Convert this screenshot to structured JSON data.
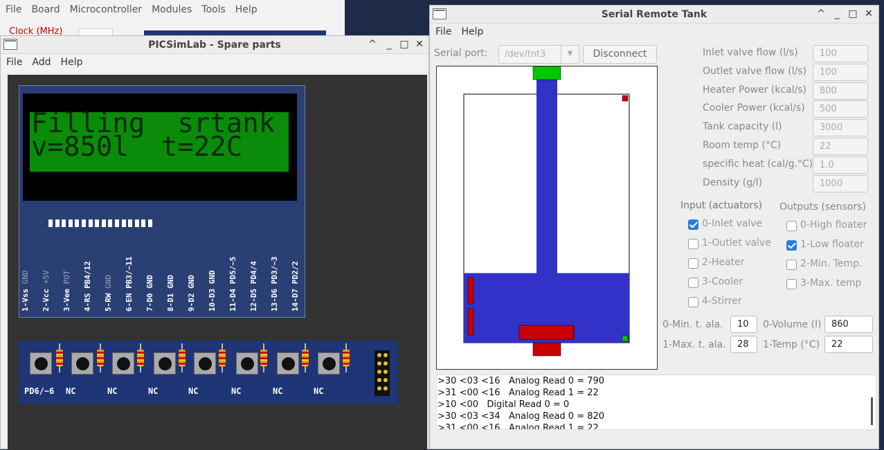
{
  "back_window": {
    "menu": [
      "File",
      "Board",
      "Microcontroller",
      "Modules",
      "Tools",
      "Help"
    ],
    "clock_label": "Clock (MHz)"
  },
  "parts_window": {
    "title": "PICSimLab - Spare parts",
    "menu": [
      "File",
      "Add",
      "Help"
    ],
    "lcd": {
      "line1": "Filling  srtank",
      "line2": "v=850l  t=22C",
      "pins": [
        {
          "label": "1-Vss",
          "net": "GND"
        },
        {
          "label": "2-Vcc",
          "net": "+5V"
        },
        {
          "label": "3-Vee",
          "net": "POT"
        },
        {
          "label": "4-RS",
          "net": "PB4/12"
        },
        {
          "label": "5-RW",
          "net": "GND"
        },
        {
          "label": "6-EN",
          "net": "PB3/~11"
        },
        {
          "label": "7-D0",
          "net": "GND"
        },
        {
          "label": "8-D1",
          "net": "GND"
        },
        {
          "label": "9-D2",
          "net": "GND"
        },
        {
          "label": "10-D3",
          "net": "GND"
        },
        {
          "label": "11-D4",
          "net": "PD5/~5"
        },
        {
          "label": "12-D5",
          "net": "PD4/4"
        },
        {
          "label": "13-D6",
          "net": "PD3/~3"
        },
        {
          "label": "14-D7",
          "net": "PD2/2"
        }
      ]
    },
    "buttons": [
      "PD6/~6",
      "NC",
      "NC",
      "NC",
      "NC",
      "NC",
      "NC",
      "NC"
    ]
  },
  "tank_window": {
    "title": "Serial Remote Tank",
    "menu": [
      "File",
      "Help"
    ],
    "serial_port_label": "Serial port:",
    "serial_port_value": "/dev/tnt3",
    "disconnect_label": "Disconnect",
    "params": [
      {
        "label": "Inlet valve flow (l/s)",
        "value": "100"
      },
      {
        "label": "Outlet valve flow (l/s)",
        "value": "100"
      },
      {
        "label": "Heater Power (kcal/s)",
        "value": "800"
      },
      {
        "label": "Cooler Power (kcal/s)",
        "value": "500"
      },
      {
        "label": "Tank capacity (l)",
        "value": "3000"
      },
      {
        "label": "Room temp (°C)",
        "value": "22"
      },
      {
        "label": "specific heat (cal/g.°C)",
        "value": "1.0"
      },
      {
        "label": "Density (g/l)",
        "value": "1000"
      }
    ],
    "inputs_title": "Input (actuators)",
    "outputs_title": "Outputs (sensors)",
    "inputs": [
      {
        "label": "0-Inlet valve",
        "checked": true
      },
      {
        "label": "1-Outlet valve",
        "checked": false
      },
      {
        "label": "2-Heater",
        "checked": false
      },
      {
        "label": "3-Cooler",
        "checked": false
      },
      {
        "label": "4-Stirrer",
        "checked": false
      }
    ],
    "outputs": [
      {
        "label": "0-High floater",
        "checked": false
      },
      {
        "label": "1-Low floater",
        "checked": true
      },
      {
        "label": "2-Min. Temp.",
        "checked": false
      },
      {
        "label": "3-Max. temp",
        "checked": false
      }
    ],
    "analog": [
      {
        "label": "0-Min. t. ala.",
        "value": "10"
      },
      {
        "label": "1-Max. t. ala.",
        "value": "28"
      },
      {
        "label": "0-Volume (l)",
        "value": "860"
      },
      {
        "label": "1-Temp (°C)",
        "value": "22"
      }
    ],
    "tank_level": 0.28,
    "log": [
      ">30 <03 <16   Analog Read 0 = 790",
      ">31 <00 <16   Analog Read 1 = 22",
      ">10 <00   Digital Read 0 = 0",
      ">30 <03 <34   Analog Read 0 = 820",
      ">31 <00 <16   Analog Read 1 = 22"
    ],
    "colors": {
      "water": "#3232c8",
      "valve_open": "#00c800",
      "valve_closed": "#c80000"
    }
  }
}
